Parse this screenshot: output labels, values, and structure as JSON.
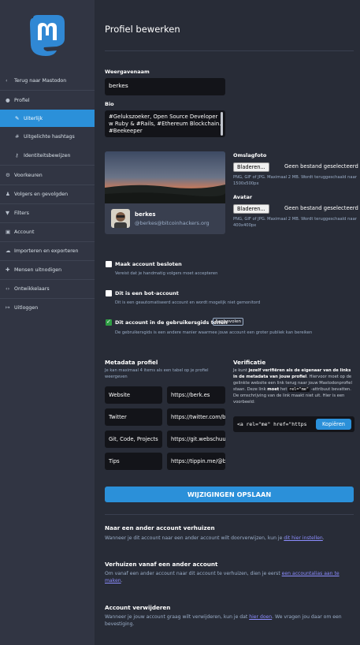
{
  "sidebar": {
    "items": [
      {
        "label": "Terug naar Mastodon",
        "icon": "chevron-left-icon",
        "glyph": "‹"
      },
      {
        "label": "Profiel",
        "icon": "user-icon",
        "glyph": "●"
      },
      {
        "label": "Uiterlijk",
        "icon": "pencil-icon",
        "glyph": "✎"
      },
      {
        "label": "Uitgelichte hashtags",
        "icon": "hashtag-icon",
        "glyph": "#"
      },
      {
        "label": "Identiteitsbewijzen",
        "icon": "key-icon",
        "glyph": "⚷"
      },
      {
        "label": "Voorkeuren",
        "icon": "gear-icon",
        "glyph": "⚙"
      },
      {
        "label": "Volgers en gevolgden",
        "icon": "users-icon",
        "glyph": "♟"
      },
      {
        "label": "Filters",
        "icon": "filter-icon",
        "glyph": "▼"
      },
      {
        "label": "Account",
        "icon": "lock-icon",
        "glyph": "▣"
      },
      {
        "label": "Importeren en exporteren",
        "icon": "cloud-icon",
        "glyph": "☁"
      },
      {
        "label": "Mensen uitnodigen",
        "icon": "user-plus-icon",
        "glyph": "✚"
      },
      {
        "label": "Ontwikkelaars",
        "icon": "code-icon",
        "glyph": "‹›"
      },
      {
        "label": "Uitloggen",
        "icon": "sign-out-icon",
        "glyph": "↦"
      }
    ]
  },
  "page": {
    "title": "Profiel bewerken"
  },
  "form": {
    "display_name_label": "Weergavenaam",
    "display_name_value": "berkes",
    "bio_label": "Bio",
    "bio_value": "#Gelukszoeker, Open Source Developer w Ruby & #Rails, #Ethereum Blockchain. #Beekeeper",
    "header_label": "Omslagfoto",
    "header_button": "Bladeren...",
    "header_status": "Geen bestand geselecteerd",
    "header_hint": "PNG, GIF of JPG. Maximaal 2 MB. Wordt teruggeschaald naar 1500x500px",
    "avatar_label": "Avatar",
    "avatar_button": "Bladeren...",
    "avatar_status": "Geen bestand geselecteerd",
    "avatar_hint": "PNG, GIF of JPG. Maximaal 2 MB. Wordt teruggeschaald naar 400x400px",
    "locked_label": "Maak account besloten",
    "locked_hint": "Vereist dat je handmatig volgers moet accepteren",
    "bot_label": "Dit is een bot-account",
    "bot_hint": "Dit is een geautomatiseerd account en wordt mogelijk niet gemonitord",
    "discover_label": "Dit account in de gebruikersgids tonen",
    "discover_badge": "Aanbevolen",
    "discover_hint": "De gebruikersgids is een andere manier waarmee jouw account een groter publiek kan bereiken"
  },
  "preview": {
    "name": "berkes",
    "handle": "@berkes@bitcoinhackers.org"
  },
  "metadata": {
    "title": "Metadata profiel",
    "hint": "Je kan maximaal 4 items als een tabel op je profiel weergeven",
    "rows": [
      {
        "key": "Website",
        "value": "https://berk.es"
      },
      {
        "key": "Twitter",
        "value": "https://twitter.com/berkes"
      },
      {
        "key": "Git, Code, Projects",
        "value": "https://git.webschuur.com"
      },
      {
        "key": "Tips",
        "value": "https://tippin.me/@berkes"
      }
    ]
  },
  "verification": {
    "title": "Verificatie",
    "text_a": "Je kunt ",
    "text_b": "jezelf verifiëren als de eigenaar van de links in de metadata van jouw profiel",
    "text_c": ". Hiervoor moet op de gelinkte website een link terug naar jouw Mastodonprofiel staan. Deze link ",
    "text_d": "moet",
    "text_e": " het ",
    "text_f": "rel=\"me\"",
    "text_g": " -attribuut bevatten. De omschrijving van de link maakt niet uit. Hier is een voorbeeld:",
    "code": "<a rel=\"me\" href=\"https://bitcoinhackers.org/@berkes\">Mastodon</a>",
    "copy_button": "Kopiëren"
  },
  "save_button": "WIJZIGINGEN OPSLAAN",
  "migrate": {
    "title": "Naar een ander account verhuizen",
    "text": "Wanneer je dit account naar een ander account wilt doorverwijzen, kun je ",
    "link": "dit hier instellen",
    "end": "."
  },
  "move_from": {
    "title": "Verhuizen vanaf een ander account",
    "text": "Om vanaf een ander account naar dit account te verhuizen, dien je eerst ",
    "link": "een accountalias aan te maken",
    "end": "."
  },
  "delete": {
    "title": "Account verwijderen",
    "text": "Wanneer je jouw account graag wilt verwijderen, kun je dat ",
    "link": "hier doen",
    "end": ". We vragen jou daar om een bevestiging."
  },
  "colors": {
    "accent": "#2b90d9",
    "background": "#282c37",
    "sidebar": "#313543",
    "input": "#131419",
    "link": "#8c8dff",
    "check": "#2f9e44"
  }
}
